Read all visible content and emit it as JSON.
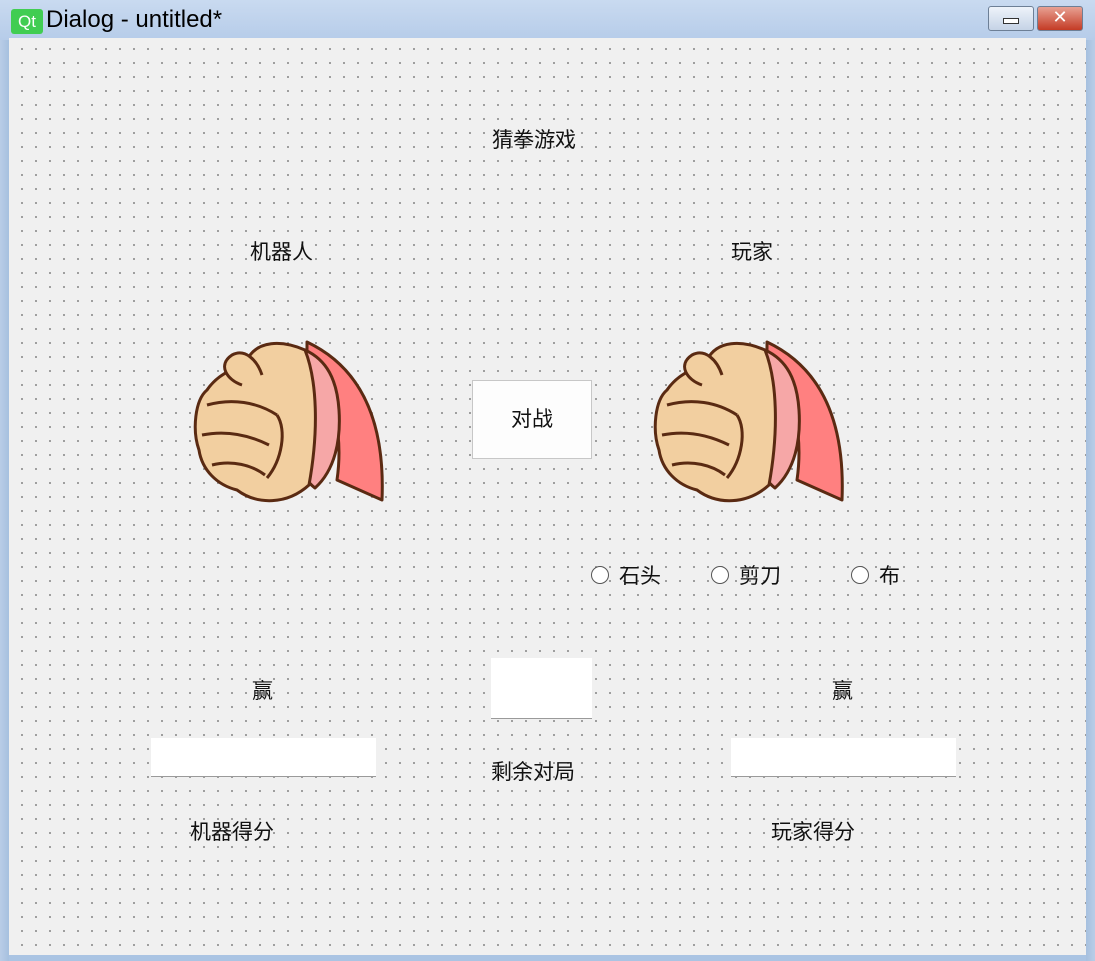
{
  "window": {
    "logo": "Qt",
    "title": "Dialog - untitled*",
    "minimize_icon": "minimize-icon",
    "close_icon": "close-icon",
    "close_glyph": "✕"
  },
  "dialog": {
    "title": "猜拳游戏",
    "robot_label": "机器人",
    "player_label": "玩家",
    "fight_button": "对战",
    "options": [
      {
        "label": "石头",
        "checked": false
      },
      {
        "label": "剪刀",
        "checked": false
      },
      {
        "label": "布",
        "checked": false
      }
    ],
    "robot_win_label": "赢",
    "player_win_label": "赢",
    "remaining_label": "剩余对局",
    "robot_score_label": "机器得分",
    "player_score_label": "玩家得分",
    "remaining_value": "",
    "robot_score_value": "",
    "player_score_value": ""
  },
  "colors": {
    "skin": "#f2cfa0",
    "outline": "#5a2a12",
    "sleeve": "#ff8080",
    "cuff": "#f6a7a7",
    "qt_green": "#41cd52"
  }
}
